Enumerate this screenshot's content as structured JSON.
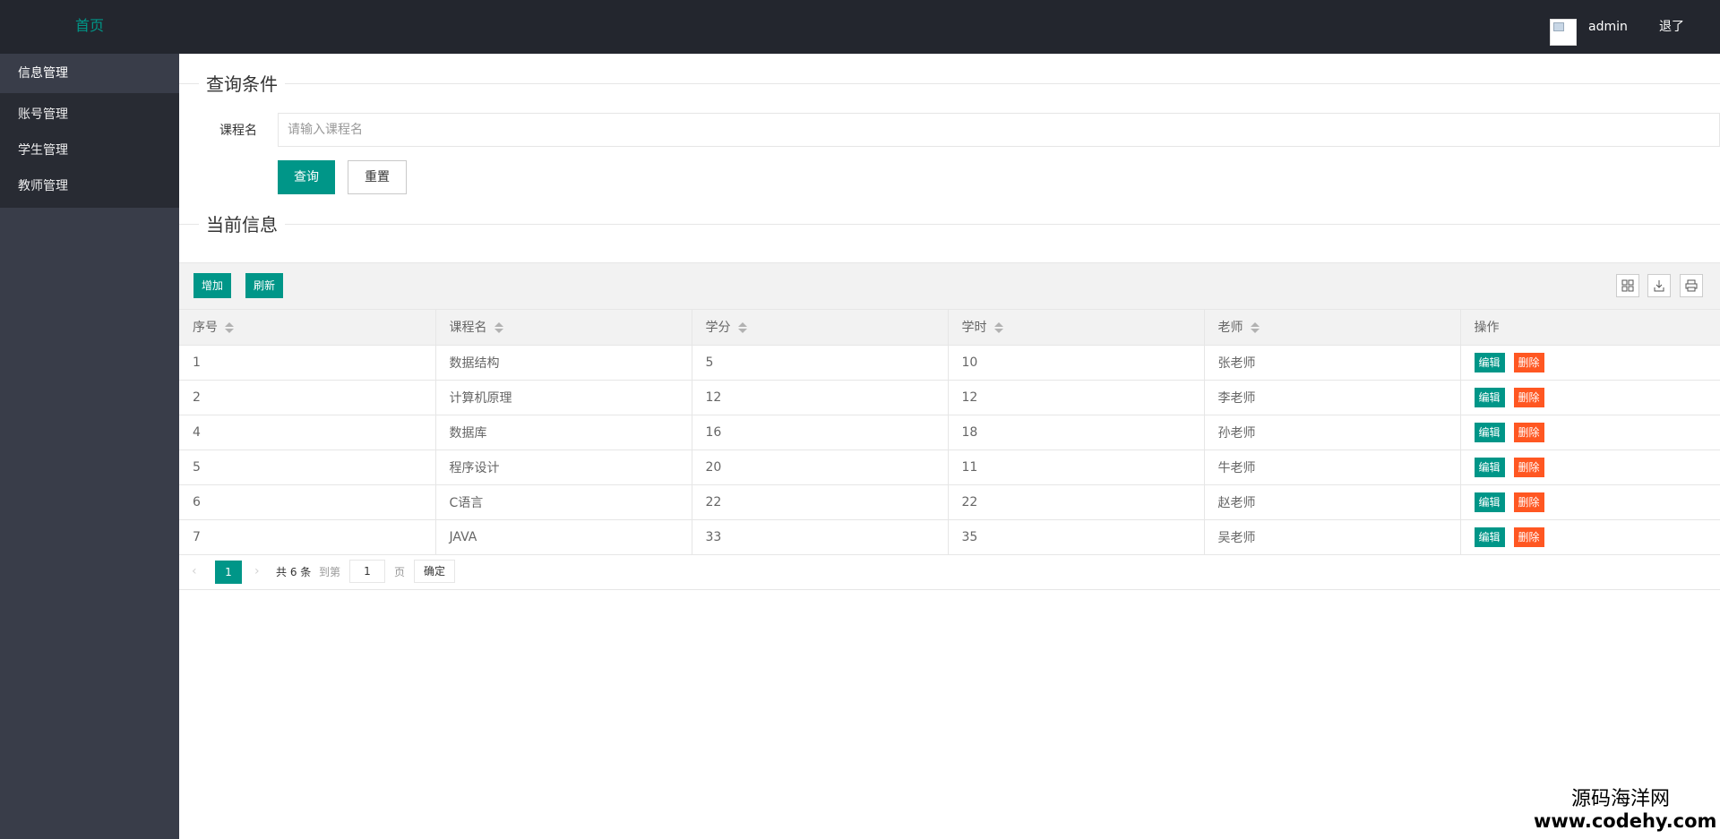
{
  "header": {
    "home": "首页",
    "username": "admin",
    "logout": "退了"
  },
  "sidebar": {
    "group": "信息管理",
    "items": [
      "账号管理",
      "学生管理",
      "教师管理"
    ]
  },
  "search": {
    "section_title": "查询条件",
    "label": "课程名",
    "placeholder": "请输入课程名",
    "value": "",
    "query_button": "查询",
    "reset_button": "重置"
  },
  "current": {
    "section_title": "当前信息",
    "add_button": "增加",
    "refresh_button": "刷新",
    "toolbar_icons": [
      "columns-icon",
      "export-icon",
      "print-icon"
    ]
  },
  "table": {
    "columns": [
      "序号",
      "课程名",
      "学分",
      "学时",
      "老师",
      "操作"
    ],
    "rows": [
      [
        "1",
        "数据结构",
        "5",
        "10",
        "张老师"
      ],
      [
        "2",
        "计算机原理",
        "12",
        "12",
        "李老师"
      ],
      [
        "4",
        "数据库",
        "16",
        "18",
        "孙老师"
      ],
      [
        "5",
        "程序设计",
        "20",
        "11",
        "牛老师"
      ],
      [
        "6",
        "C语言",
        "22",
        "22",
        "赵老师"
      ],
      [
        "7",
        "JAVA",
        "33",
        "35",
        "吴老师"
      ]
    ],
    "edit_label": "编辑",
    "delete_label": "删除"
  },
  "pager": {
    "prev": "‹",
    "current": "1",
    "next": "›",
    "total": "共 6 条",
    "goto_label": "到第",
    "goto_value": "1",
    "page_unit": "页",
    "confirm": "确定"
  },
  "watermark": {
    "line1": "源码海洋网",
    "line2": "www.codehy.com"
  },
  "colors": {
    "header_bg": "#23262e",
    "sidebar_bg": "#393d49",
    "sidebar_sub_bg": "#282b33",
    "primary": "#009688",
    "danger": "#ff5722"
  }
}
